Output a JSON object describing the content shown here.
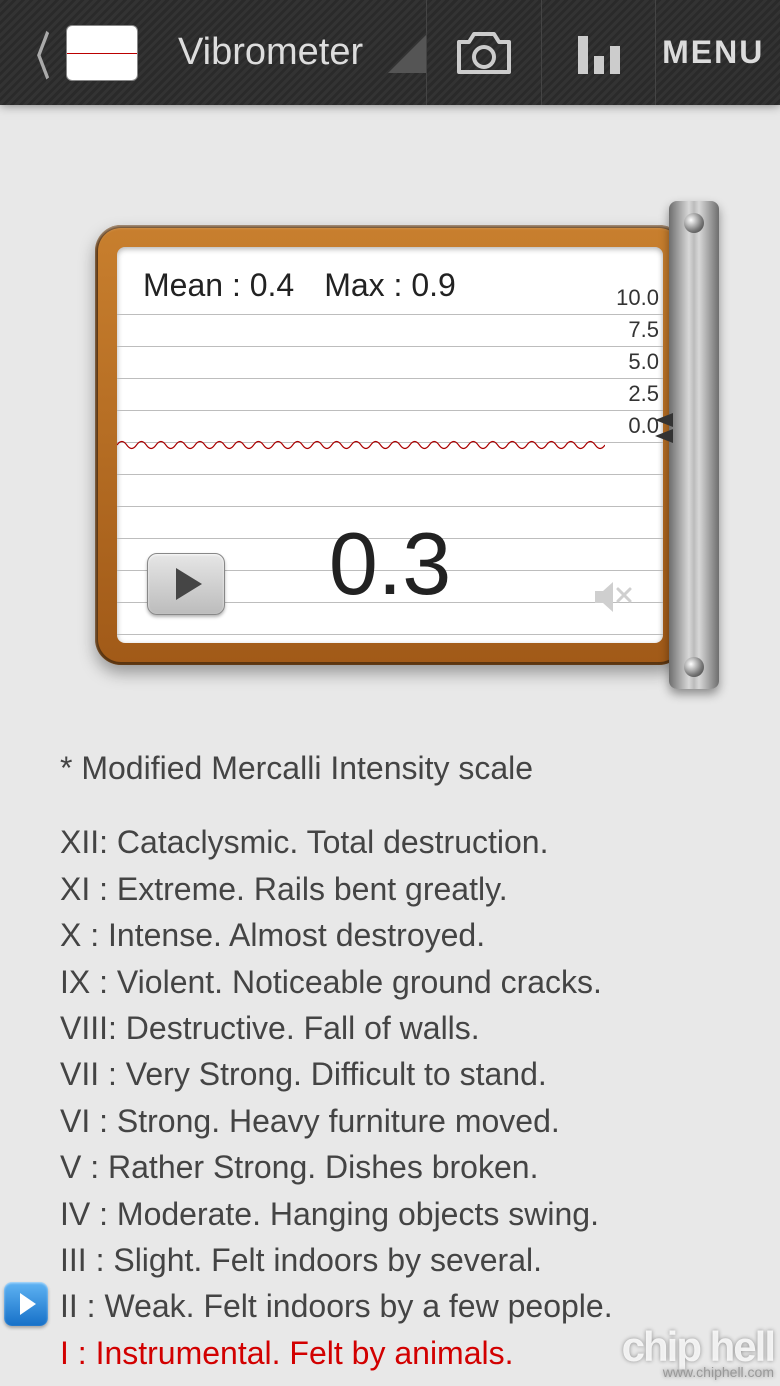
{
  "header": {
    "title": "Vibrometer",
    "menu_label": "MENU"
  },
  "meter": {
    "mean_label": "Mean : 0.4",
    "max_label": "Max : 0.9",
    "current_reading": "0.3",
    "y_ticks": [
      "10.0",
      "7.5",
      "5.0",
      "2.5",
      "0.0"
    ]
  },
  "scale": {
    "title": "* Modified Mercalli Intensity scale",
    "rows": [
      {
        "text": "XII: Cataclysmic. Total destruction.",
        "highlight": false
      },
      {
        "text": "XI : Extreme. Rails bent greatly.",
        "highlight": false
      },
      {
        "text": "X  : Intense. Almost destroyed.",
        "highlight": false
      },
      {
        "text": "IX : Violent. Noticeable ground cracks.",
        "highlight": false
      },
      {
        "text": "VIII: Destructive. Fall of walls.",
        "highlight": false
      },
      {
        "text": "VII : Very Strong. Difficult to stand.",
        "highlight": false
      },
      {
        "text": "VI : Strong. Heavy furniture moved.",
        "highlight": false
      },
      {
        "text": "V  : Rather Strong. Dishes broken.",
        "highlight": false
      },
      {
        "text": "IV : Moderate. Hanging objects swing.",
        "highlight": false
      },
      {
        "text": "III : Slight. Felt indoors by several.",
        "highlight": false
      },
      {
        "text": "II : Weak. Felt indoors by a few people.",
        "highlight": false
      },
      {
        "text": "I  : Instrumental. Felt by animals.",
        "highlight": true
      }
    ]
  },
  "watermark": {
    "brand": "chip hell",
    "url": "www.chiphell.com"
  }
}
